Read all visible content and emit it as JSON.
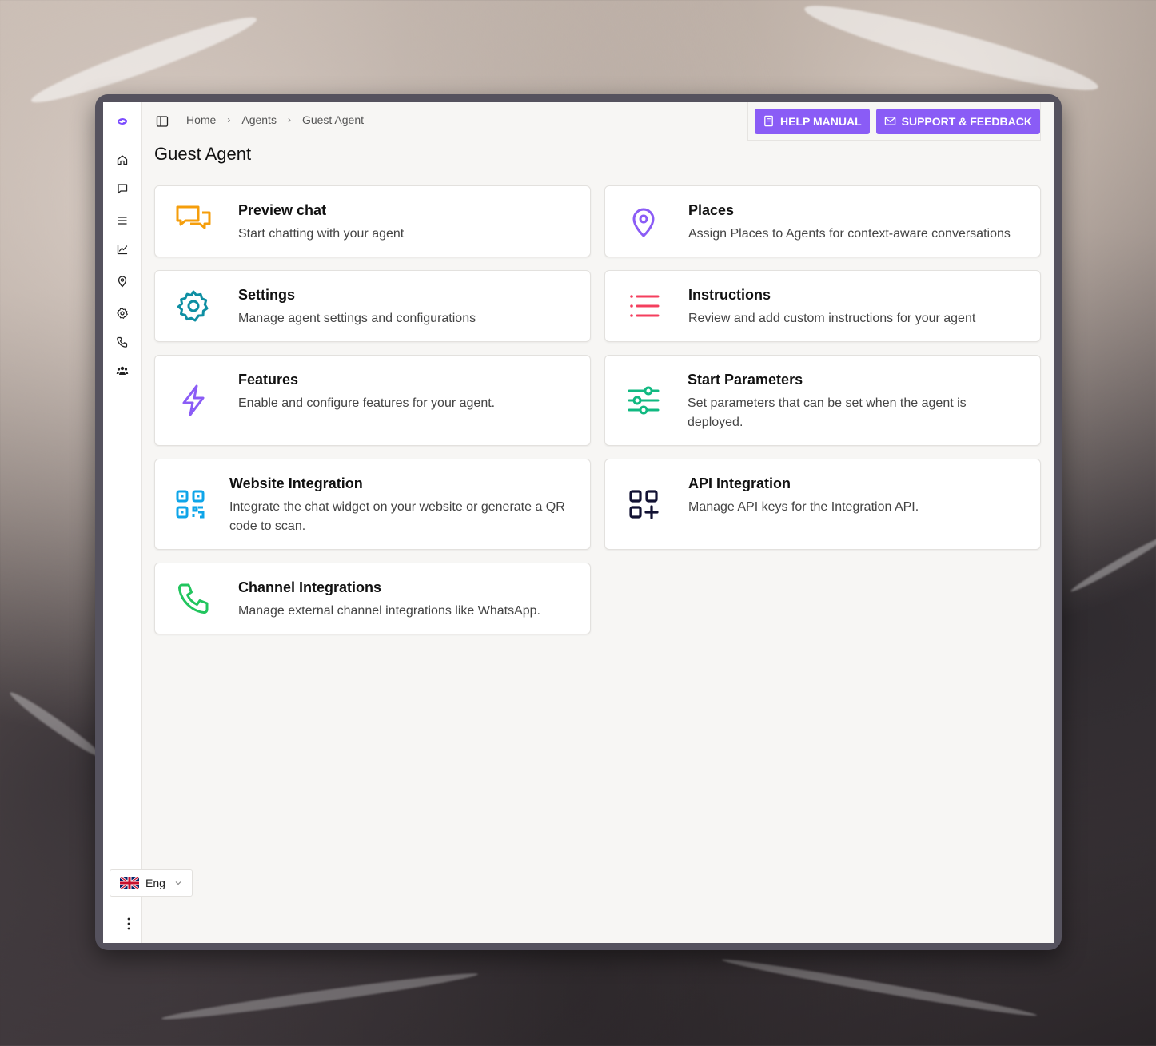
{
  "breadcrumb": {
    "home": "Home",
    "agents": "Agents",
    "current": "Guest Agent"
  },
  "actions": {
    "help": "HELP MANUAL",
    "support": "SUPPORT & FEEDBACK"
  },
  "page": {
    "title": "Guest Agent"
  },
  "language": {
    "label": "Eng"
  },
  "cards": [
    {
      "title": "Preview chat",
      "desc": "Start chatting with your agent",
      "icon": "chat-bubbles-icon",
      "color": "#f59e0b"
    },
    {
      "title": "Places",
      "desc": "Assign Places to Agents for context-aware conversations",
      "icon": "map-pin-icon",
      "color": "#8b5cf6"
    },
    {
      "title": "Settings",
      "desc": "Manage agent settings and configurations",
      "icon": "gear-icon",
      "color": "#0e8fa3"
    },
    {
      "title": "Instructions",
      "desc": "Review and add custom instructions for your agent",
      "icon": "list-icon",
      "color": "#f43f5e"
    },
    {
      "title": "Features",
      "desc": "Enable and configure features for your agent.",
      "icon": "lightning-icon",
      "color": "#8b5cf6"
    },
    {
      "title": "Start Parameters",
      "desc": "Set parameters that can be set when the agent is deployed.",
      "icon": "sliders-icon",
      "color": "#10b981"
    },
    {
      "title": "Website Integration",
      "desc": "Integrate the chat widget on your website or generate a QR code to scan.",
      "icon": "qr-code-icon",
      "color": "#0ea5e9"
    },
    {
      "title": "API Integration",
      "desc": "Manage API keys for the Integration API.",
      "icon": "squares-plus-icon",
      "color": "#111133"
    },
    {
      "title": "Channel Integrations",
      "desc": "Manage external channel integrations like WhatsApp.",
      "icon": "phone-icon",
      "color": "#22c55e"
    }
  ],
  "sidebar": [
    "home-icon",
    "chat-icon",
    "menu-icon",
    "chart-icon",
    "map-pin-icon",
    "gear-icon",
    "phone-icon",
    "users-icon"
  ]
}
